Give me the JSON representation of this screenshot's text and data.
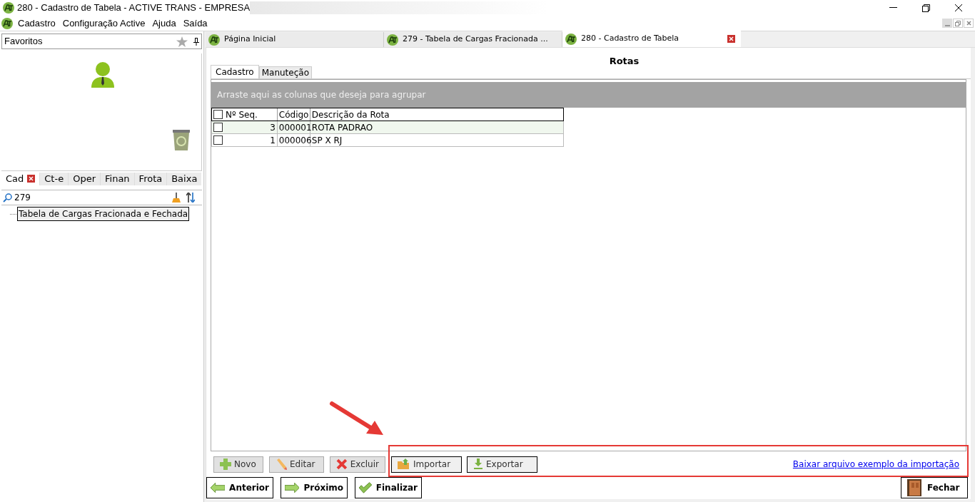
{
  "window": {
    "title": "280 - Cadastro de Tabela - ACTIVE TRANS - EMPRESA"
  },
  "menu": [
    "Cadastro",
    "Configuração Active",
    "Ajuda",
    "Saída"
  ],
  "sidebar": {
    "favorites_label": "Favoritos",
    "tabs": [
      {
        "label": "Cad",
        "selected": true
      },
      {
        "label": "Ct-e",
        "selected": false
      },
      {
        "label": "Oper",
        "selected": false
      },
      {
        "label": "Finan",
        "selected": false
      },
      {
        "label": "Frota",
        "selected": false
      },
      {
        "label": "Baixa",
        "selected": false
      }
    ],
    "search": {
      "value": "279"
    },
    "tree": [
      {
        "label": "Tabela de Cargas Fracionada e Fechada",
        "selected": true
      }
    ]
  },
  "doc_tabs": [
    {
      "label": "Página Inicial",
      "selected": false
    },
    {
      "label": "279 - Tabela de Cargas Fracionada ...",
      "selected": false
    },
    {
      "label": "280 - Cadastro de Tabela",
      "selected": true
    }
  ],
  "heading": "Rotas",
  "sub_tabs": [
    {
      "label": "Cadastro",
      "selected": true
    },
    {
      "label": "Manuteção",
      "selected": false
    }
  ],
  "group_hint": "Arraste aqui as colunas que deseja para agrupar",
  "table": {
    "all_checked": false,
    "columns": [
      "Nº Seq.",
      "Código",
      "Descrição da Rota"
    ],
    "rows": [
      {
        "cells": [
          "3",
          "000001",
          "ROTA PADRAO"
        ],
        "checked": false,
        "selected": true
      },
      {
        "cells": [
          "1",
          "000006",
          "SP X RJ"
        ],
        "checked": false,
        "selected": false
      }
    ]
  },
  "actions": [
    {
      "label": "Novo",
      "kind": "plus"
    },
    {
      "label": "Editar",
      "kind": "pencil"
    },
    {
      "label": "Excluir",
      "kind": "cross"
    },
    {
      "label": "Importar",
      "kind": "import"
    },
    {
      "label": "Exportar",
      "kind": "export"
    }
  ],
  "link": "Baixar arquivo exemplo da importação",
  "nav": [
    {
      "label": "Anterior",
      "kind": "back"
    },
    {
      "label": "Próximo",
      "kind": "next"
    },
    {
      "label": "Finalizar",
      "kind": "finish"
    }
  ],
  "close_label": "Fechar"
}
